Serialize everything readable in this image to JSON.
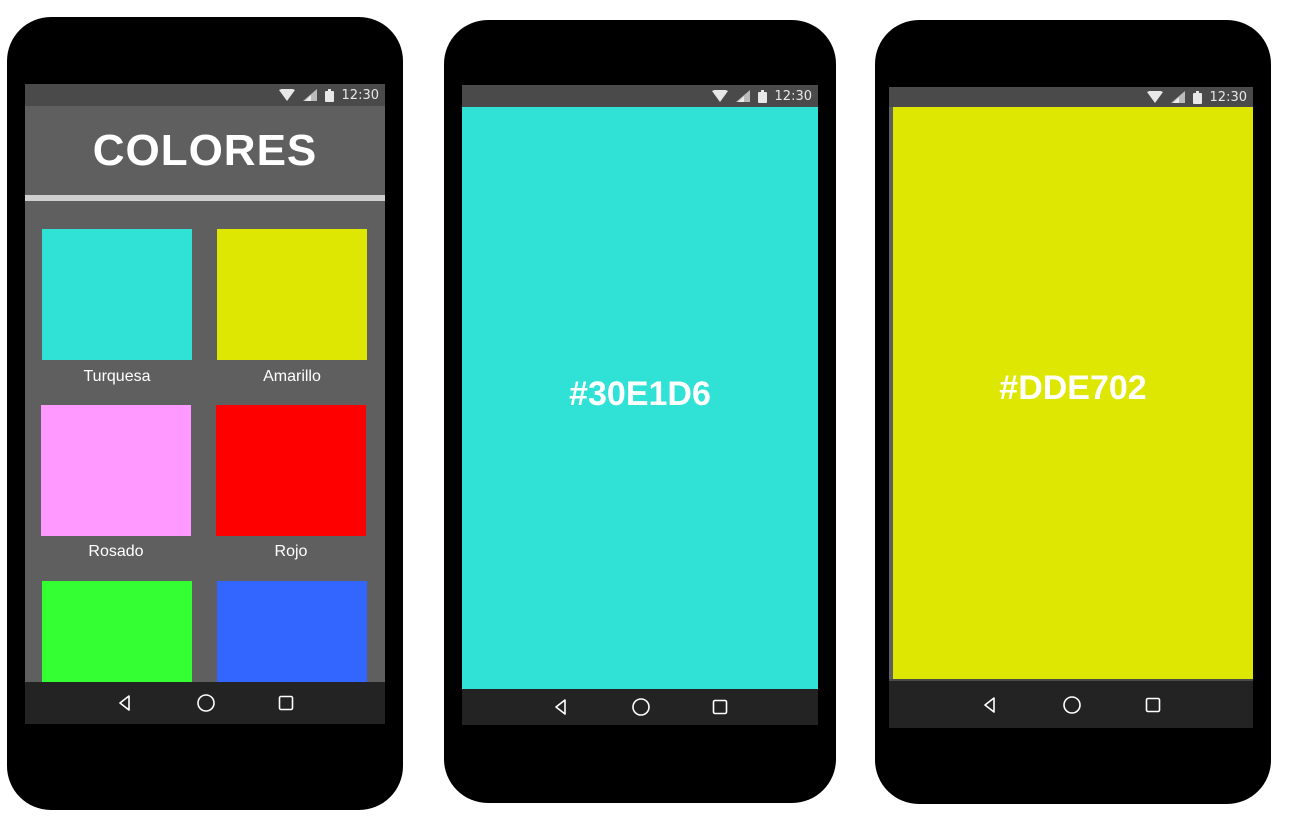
{
  "status_time": "12:30",
  "phone1": {
    "title": "COLORES",
    "colors": [
      {
        "name": "Turquesa",
        "hex": "#30E1D6"
      },
      {
        "name": "Amarillo",
        "hex": "#DDE702"
      },
      {
        "name": "Rosado",
        "hex": "#FF99FF"
      },
      {
        "name": "Rojo",
        "hex": "#FF0000"
      },
      {
        "name": "",
        "hex": "#33FF33"
      },
      {
        "name": "",
        "hex": "#3366FF"
      }
    ]
  },
  "phone2": {
    "hex_label": "#30E1D6",
    "color": "#30E1D6"
  },
  "phone3": {
    "hex_label": "#DDE702",
    "color": "#DDE702"
  },
  "icons": {
    "status": [
      "wifi-icon",
      "signal-icon",
      "battery-icon"
    ],
    "nav": [
      "back-icon",
      "home-icon",
      "recents-icon"
    ]
  }
}
